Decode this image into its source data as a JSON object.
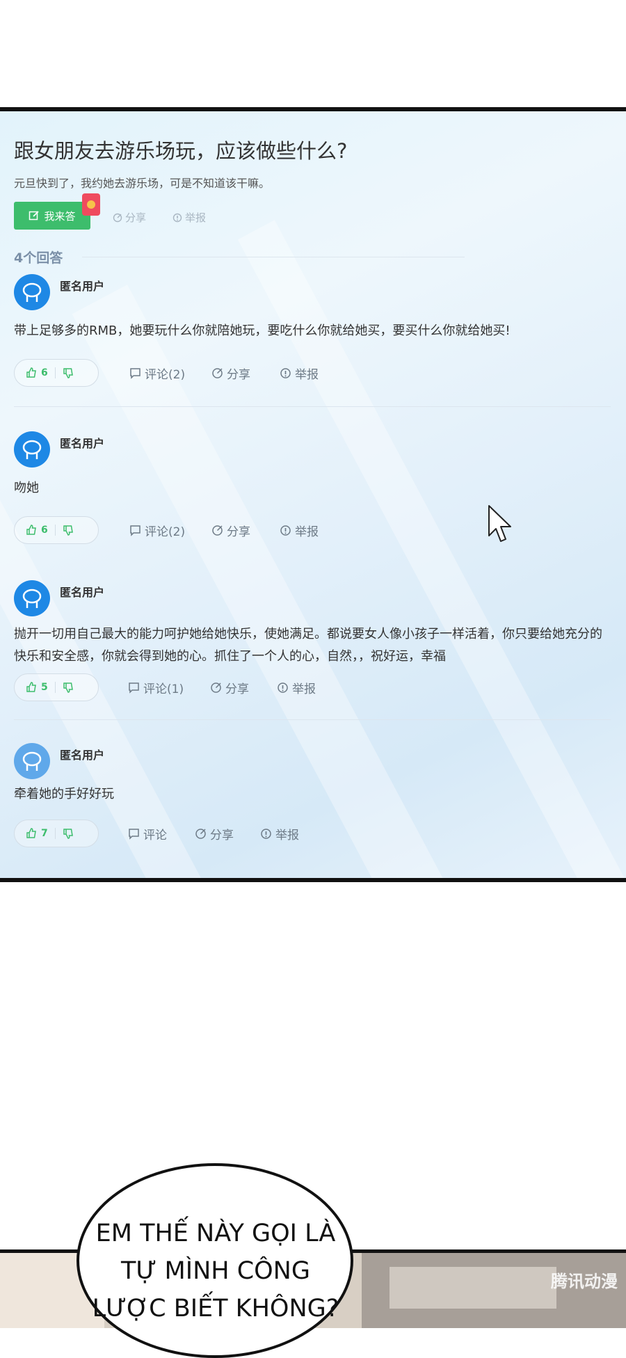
{
  "question": {
    "title": "跟女朋友去游乐场玩，应该做些什么?",
    "description": "元旦快到了，我约她去游乐场，可是不知道该干嘛。",
    "answer_button": "我来答",
    "share": "分享",
    "report": "举报"
  },
  "answer_count": "4个回答",
  "answers": [
    {
      "user": "匿名用户",
      "text": "带上足够多的RMB，她要玩什么你就陪她玩，要吃什么你就给她买，要买什么你就给她买!",
      "likes": "6",
      "comment": "评论(2)",
      "share": "分享",
      "report": "举报"
    },
    {
      "user": "匿名用户",
      "text": "吻她",
      "likes": "6",
      "comment": "评论(2)",
      "share": "分享",
      "report": "举报"
    },
    {
      "user": "匿名用户",
      "text": "抛开一切用自己最大的能力呵护她给她快乐，使她满足。都说要女人像小孩子一样活着，你只要给她充分的快乐和安全感，你就会得到她的心。抓住了一个人的心，自然，，祝好运，幸福",
      "likes": "5",
      "comment": "评论(1)",
      "share": "分享",
      "report": "举报"
    },
    {
      "user": "匿名用户",
      "text": "牵着她的手好好玩",
      "likes": "7",
      "comment": "评论",
      "share": "分享",
      "report": "举报"
    }
  ],
  "comic": {
    "bubble_text": "EM THẾ NÀY GỌI LÀ TỰ MÌNH CÔNG LƯỢC BIẾT KHÔNG?",
    "watermark": "腾讯动漫"
  },
  "colors": {
    "accent_green": "#3dbd6c",
    "avatar_blue": "#1e88e5",
    "panel_border": "#111111"
  }
}
